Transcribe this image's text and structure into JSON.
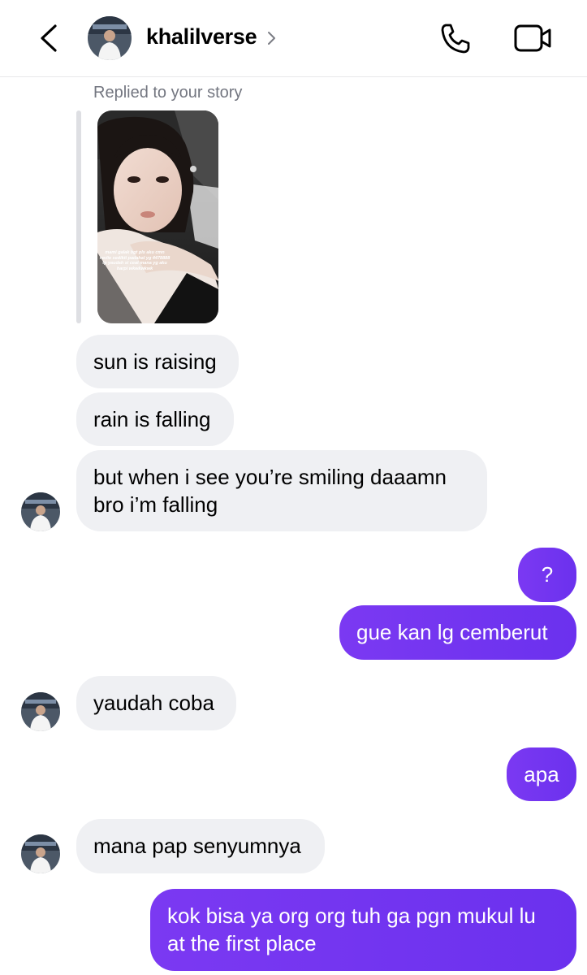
{
  "header": {
    "username": "khalilverse",
    "back_icon": "chevron-left-icon",
    "call_icon": "phone-icon",
    "video_icon": "video-camera-icon"
  },
  "story_reply": {
    "label": "Replied to your story",
    "caption": "mami galak bgt pls aku cmn ravlie sedikit padahal yg 4478888 tp yaudah si ceat mana yg aku harpi wkwkwkwk"
  },
  "messages": [
    {
      "from": "them",
      "text": "sun is raising"
    },
    {
      "from": "them",
      "text": "rain is falling"
    },
    {
      "from": "them",
      "lines": [
        "but when i see you’re smiling daaamn",
        "bro i’m falling"
      ]
    },
    {
      "from": "me",
      "text": "?"
    },
    {
      "from": "me",
      "text": "gue kan lg cemberut"
    },
    {
      "from": "them",
      "text": "yaudah coba"
    },
    {
      "from": "me",
      "text": "apa"
    },
    {
      "from": "them",
      "text": "mana pap senyumnya"
    },
    {
      "from": "me",
      "lines": [
        "kok bisa ya org org tuh ga pgn mukul lu",
        "at the first place"
      ]
    }
  ],
  "colors": {
    "outgoing_bubble": "#7234f0",
    "incoming_bubble": "#eff0f3",
    "secondary_text": "#737680"
  }
}
